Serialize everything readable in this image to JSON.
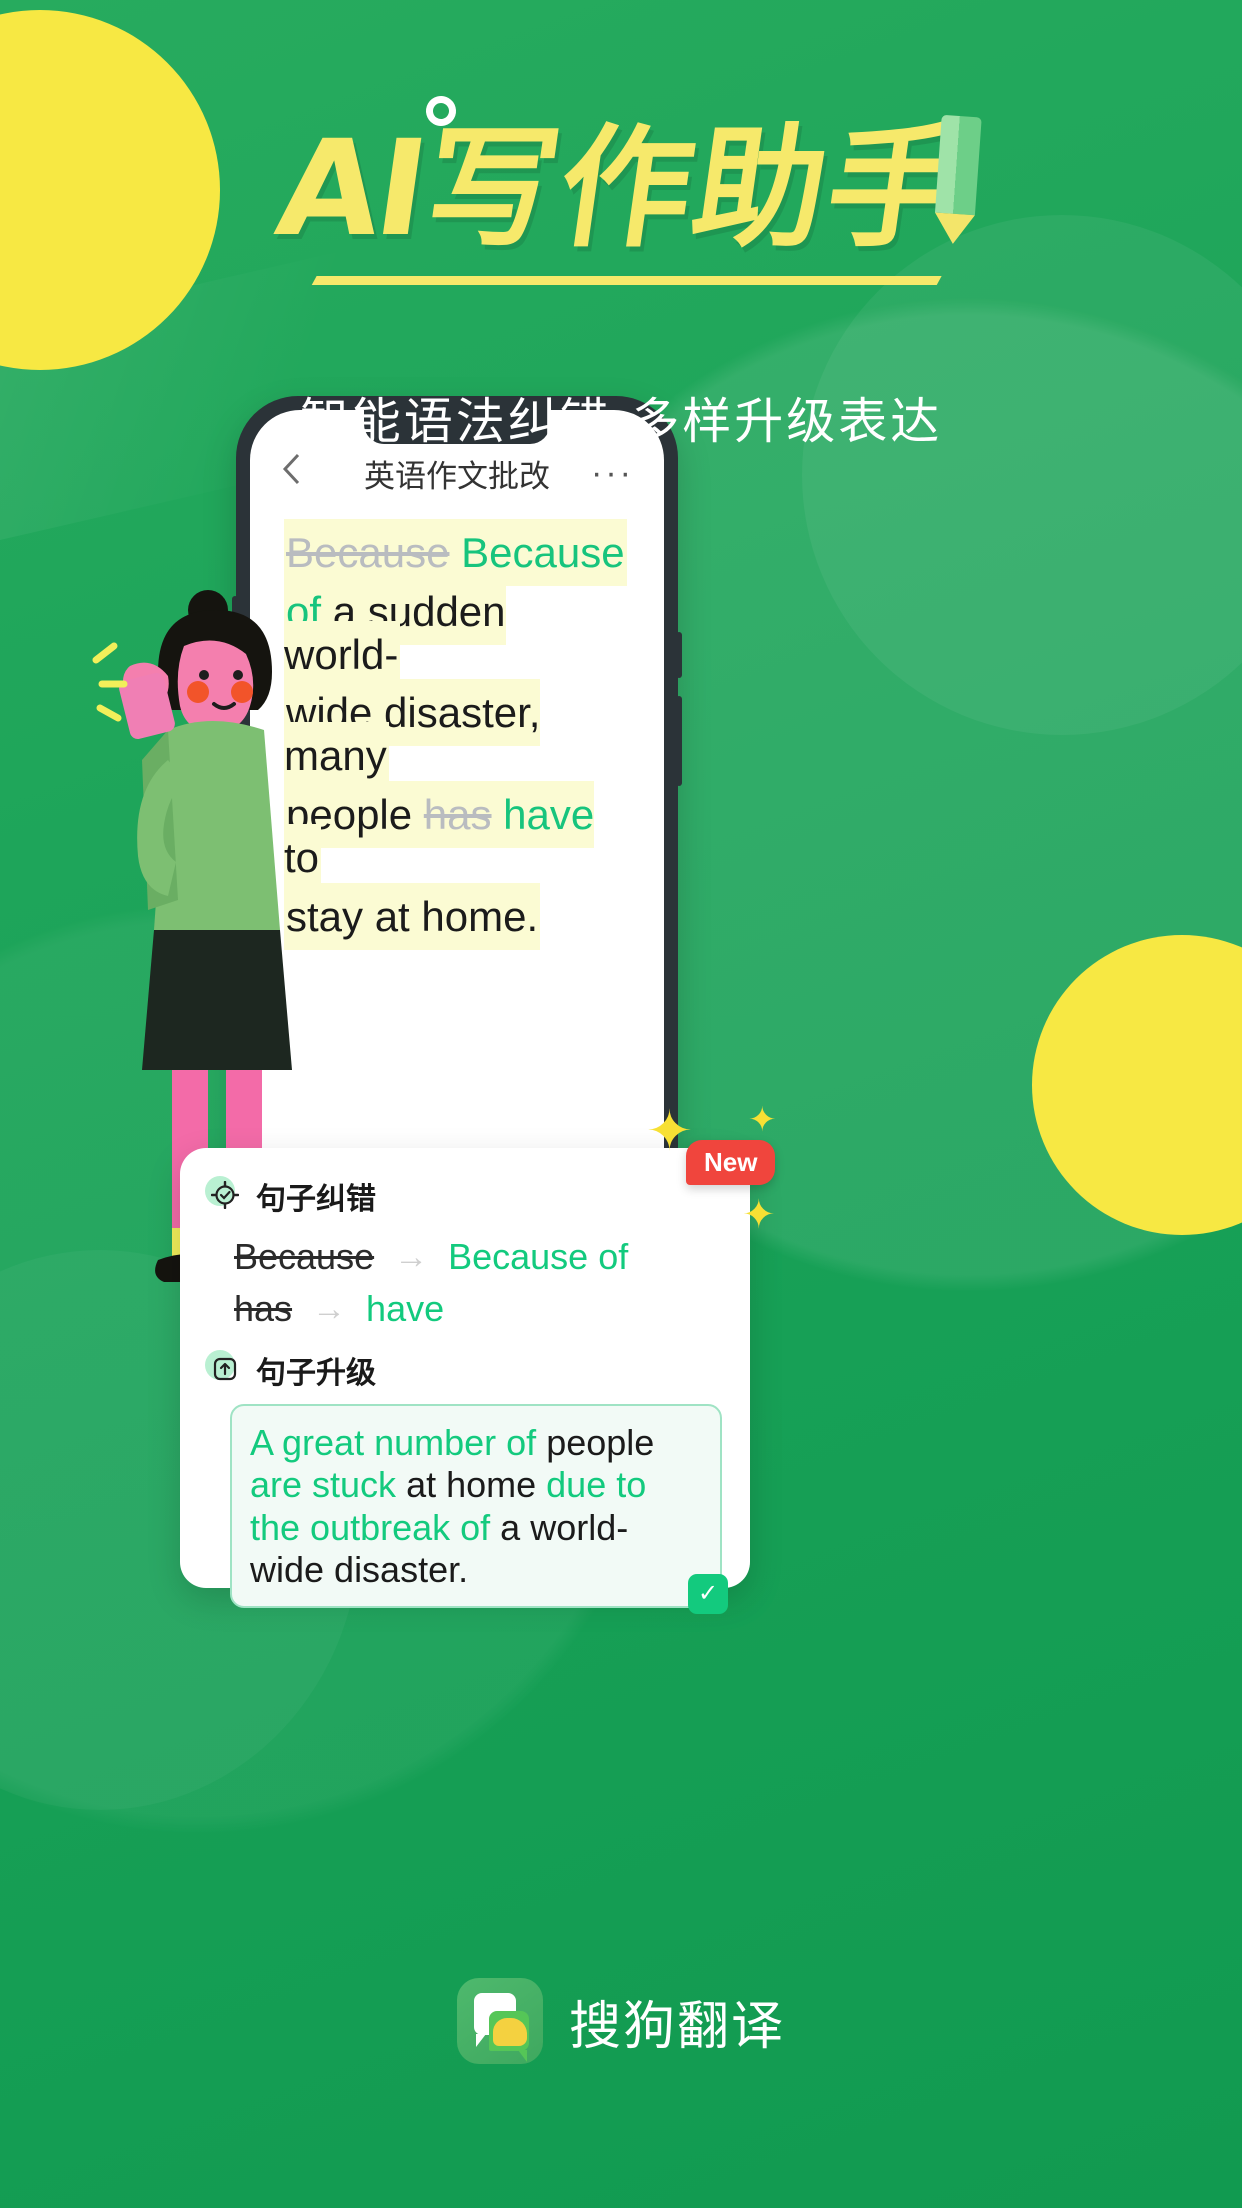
{
  "poster": {
    "headline_ai": "AI",
    "headline_cn": "写作助手",
    "subtitle": "智能语法纠错  多样升级表达"
  },
  "phone": {
    "nav": {
      "back_icon": "chevron-left-icon",
      "title": "英语作文批改",
      "more_icon": "more-horizontal-icon",
      "more_glyph": "···"
    },
    "essay_lines": [
      [
        {
          "text": "Because",
          "style": "deleted"
        },
        {
          "text": " Because",
          "style": "inserted"
        }
      ],
      [
        {
          "text": "of",
          "style": "inserted"
        },
        {
          "text": " a sudden world-",
          "style": "normal"
        }
      ],
      [
        {
          "text": "wide disaster, many",
          "style": "normal"
        }
      ],
      [
        {
          "text": "people ",
          "style": "normal"
        },
        {
          "text": "has",
          "style": "deleted"
        },
        {
          "text": " have",
          "style": "inserted"
        },
        {
          "text": " to",
          "style": "normal"
        }
      ],
      [
        {
          "text": "stay at home.",
          "style": "normal"
        }
      ]
    ]
  },
  "card": {
    "correction": {
      "icon": "target-check-icon",
      "title": "句子纠错",
      "arrow_glyph": "→",
      "rows": [
        {
          "old": "Because",
          "new": "Because of"
        },
        {
          "old": "has",
          "new": "have"
        }
      ]
    },
    "upgrade": {
      "icon": "upload-box-icon",
      "title": "句子升级",
      "lines": [
        [
          {
            "text": "A great number of ",
            "style": "green"
          },
          {
            "text": "people",
            "style": "dark"
          }
        ],
        [
          {
            "text": "are stuck ",
            "style": "green"
          },
          {
            "text": "at home ",
            "style": "dark"
          },
          {
            "text": "due to",
            "style": "green"
          }
        ],
        [
          {
            "text": "the outbreak of ",
            "style": "green"
          },
          {
            "text": "a world-",
            "style": "dark"
          }
        ],
        [
          {
            "text": "wide disaster.",
            "style": "dark"
          }
        ]
      ],
      "confirm_icon": "check-icon",
      "confirm_glyph": "✓"
    }
  },
  "badges": {
    "new_label": "New",
    "sparkle_glyph": "✦"
  },
  "footer": {
    "logo_icon": "sogou-logo-icon",
    "brand_name": "搜狗翻译"
  },
  "colors": {
    "bg_green": "#21a85c",
    "accent_yellow": "#f6e96b",
    "highlight_yellow": "#fbfbd3",
    "green_text": "#13ca7e",
    "badge_red": "#f0453d"
  }
}
